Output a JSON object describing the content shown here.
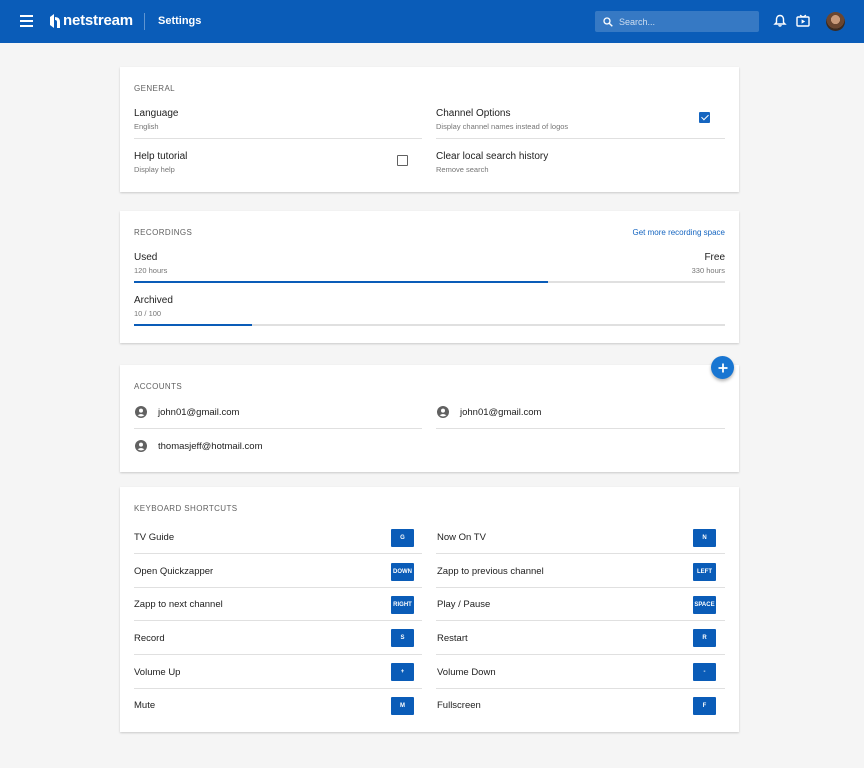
{
  "header": {
    "brand": "netstream",
    "page_title": "Settings",
    "search_placeholder": "Search...",
    "icons": [
      "menu-icon",
      "search-icon",
      "bell-icon",
      "tv-play-icon"
    ],
    "accent": "#0a5cb8"
  },
  "general": {
    "title": "GENERAL",
    "language": {
      "label": "Language",
      "value": "English"
    },
    "channel_options": {
      "label": "Channel Options",
      "description": "Display channel names instead of logos",
      "checked": true
    },
    "help_tutorial": {
      "label": "Help tutorial",
      "description": "Display help",
      "checked": false
    },
    "clear_search": {
      "label": "Clear local search history",
      "description": "Remove search"
    }
  },
  "recordings": {
    "title": "RECORDINGS",
    "more_link": "Get more recording space",
    "used": {
      "label": "Used",
      "value": "120 hours"
    },
    "free": {
      "label": "Free",
      "value": "330 hours"
    },
    "used_fraction": 0.7,
    "archived": {
      "label": "Archived",
      "value": "10 / 100"
    },
    "archived_fraction": 0.2
  },
  "accounts": {
    "title": "ACCOUNTS",
    "items": [
      "john01@gmail.com",
      "john01@gmail.com",
      "thomasjeff@hotmail.com"
    ]
  },
  "shortcuts": {
    "title": "KEYBOARD SHORTCUTS",
    "items": [
      {
        "label": "TV Guide",
        "key": "G"
      },
      {
        "label": "Now On TV",
        "key": "N"
      },
      {
        "label": "Open Quickzapper",
        "key": "DOWN"
      },
      {
        "label": "Zapp to previous channel",
        "key": "LEFT"
      },
      {
        "label": "Zapp to next channel",
        "key": "RIGHT"
      },
      {
        "label": "Play / Pause",
        "key": "SPACE"
      },
      {
        "label": "Record",
        "key": "S"
      },
      {
        "label": "Restart",
        "key": "R"
      },
      {
        "label": "Volume Up",
        "key": "+"
      },
      {
        "label": "Volume Down",
        "key": "-"
      },
      {
        "label": "Mute",
        "key": "M"
      },
      {
        "label": "Fullscreen",
        "key": "F"
      }
    ]
  }
}
